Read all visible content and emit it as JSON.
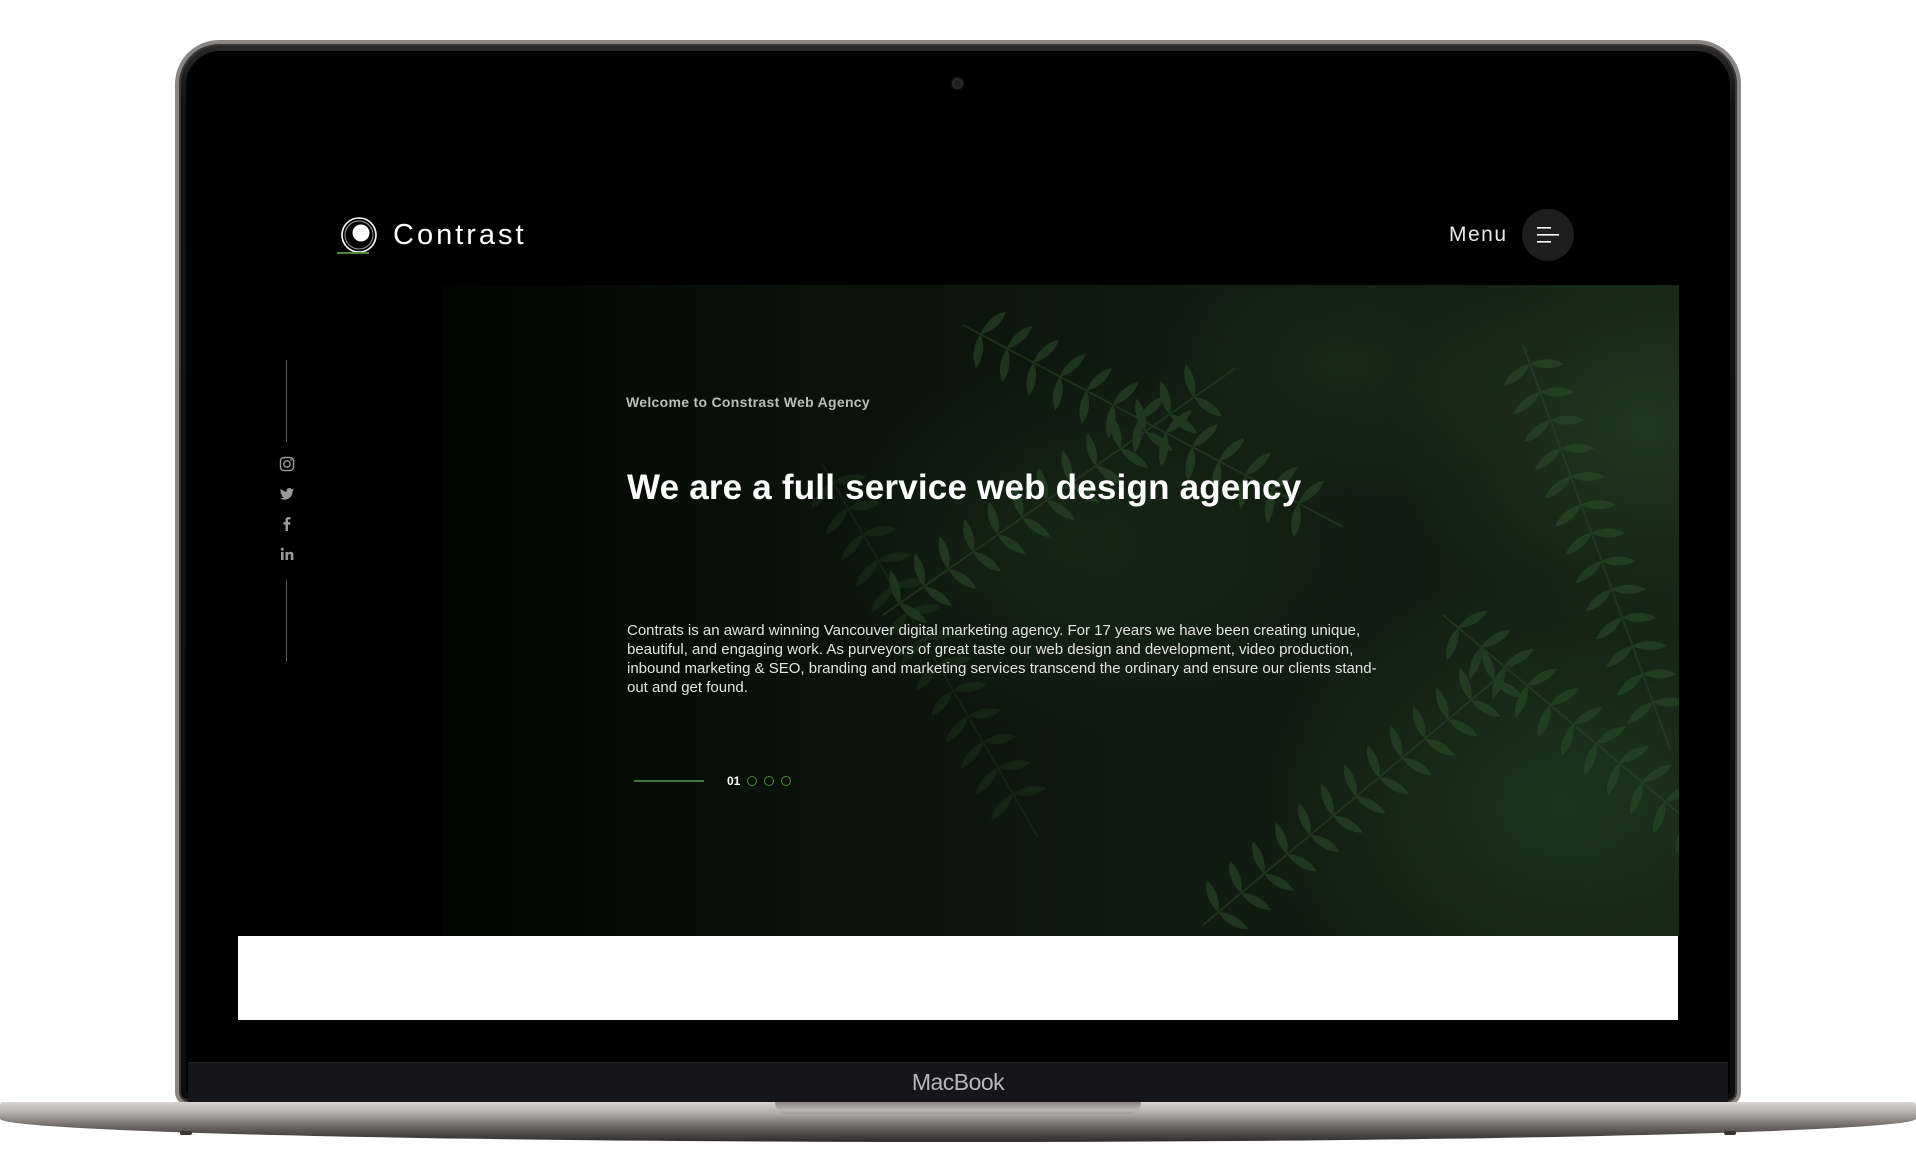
{
  "device": {
    "label": "MacBook"
  },
  "site": {
    "logo": {
      "text": "Contrast",
      "icon": "ring-logo-icon"
    },
    "menu": {
      "label": "Menu",
      "icon": "hamburger-icon"
    },
    "social": [
      {
        "name": "instagram",
        "icon": "instagram-icon"
      },
      {
        "name": "twitter",
        "icon": "twitter-icon"
      },
      {
        "name": "facebook",
        "icon": "facebook-icon"
      },
      {
        "name": "linkedin",
        "icon": "linkedin-icon"
      }
    ],
    "hero": {
      "kicker": "Welcome to Constrast Web Agency",
      "headline": "We are a full service web design agency",
      "body": "Contrats is an award winning Vancouver digital marketing agency. For 17 years we have been creating unique, beautiful, and engaging work. As purveyors of great taste our web design and development, video production, inbound marketing & SEO, branding and marketing services transcend the ordinary and ensure our clients stand-out and get found.",
      "slider": {
        "current": "01",
        "total_dots": 3
      }
    },
    "colors": {
      "background": "#000000",
      "accent": "#4a8a3a",
      "text": "#ffffff"
    }
  }
}
